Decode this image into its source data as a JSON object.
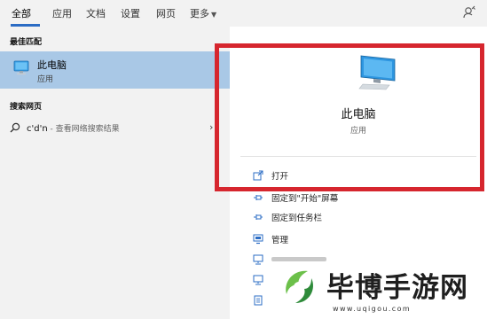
{
  "tabs": [
    {
      "label": "全部",
      "active": true
    },
    {
      "label": "应用"
    },
    {
      "label": "文档"
    },
    {
      "label": "设置"
    },
    {
      "label": "网页"
    },
    {
      "label": "更多"
    }
  ],
  "left_pane": {
    "best_match_label": "最佳匹配",
    "best_match": {
      "title": "此电脑",
      "subtitle": "应用",
      "icon": "computer-icon"
    },
    "web_label": "搜索网页",
    "web_item": {
      "query": "c'd'n",
      "hint": " - 查看网络搜索结果",
      "icon": "search-icon",
      "arrow": "›"
    }
  },
  "right_pane": {
    "title": "此电脑",
    "subtitle": "应用",
    "actions": [
      {
        "label": "打开",
        "icon": "open-icon"
      },
      {
        "label": "固定到\"开始\"屏幕",
        "icon": "pin-start-icon"
      },
      {
        "label": "固定到任务栏",
        "icon": "pin-taskbar-icon"
      },
      {
        "label": "管理",
        "icon": "manage-icon"
      }
    ]
  },
  "highlight_color": "#d6262e",
  "accent_color": "#2b6cc4",
  "watermark": {
    "text": "毕博手游网",
    "url": "www.uqigou.com"
  }
}
